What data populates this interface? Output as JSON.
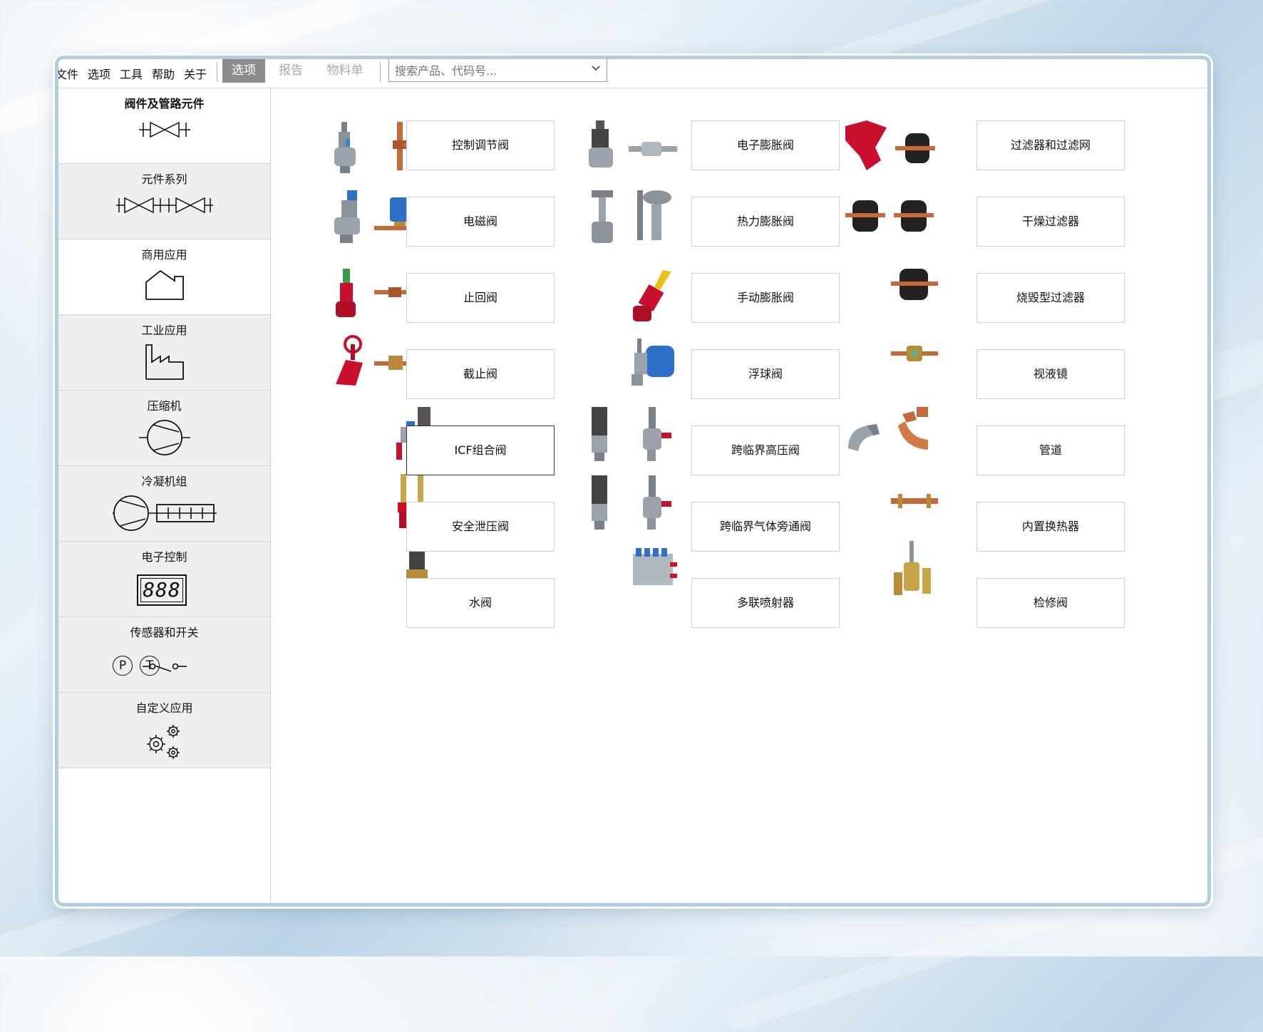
{
  "menu": {
    "items": [
      "文件",
      "选项",
      "工具",
      "帮助",
      "关于"
    ],
    "tabs": [
      {
        "label": "选项",
        "state": "active"
      },
      {
        "label": "报告",
        "state": "disabled"
      },
      {
        "label": "物料单",
        "state": "disabled"
      }
    ],
    "search_placeholder": "搜索产品、代码号..."
  },
  "sidebar": {
    "categories": [
      {
        "label": "阀件及管路元件",
        "icon": "valve-symbol-icon"
      },
      {
        "label": "元件系列",
        "icon": "double-valve-symbol-icon"
      },
      {
        "label": "商用应用",
        "icon": "house-outline-icon"
      },
      {
        "label": "工业应用",
        "icon": "factory-outline-icon"
      },
      {
        "label": "压缩机",
        "icon": "compressor-symbol-icon"
      },
      {
        "label": "冷凝机组",
        "icon": "condensing-unit-symbol-icon"
      },
      {
        "label": "电子控制",
        "icon": "digital-display-888-icon"
      },
      {
        "label": "传感器和开关",
        "icon": "pressure-temperature-switch-icon"
      },
      {
        "label": "自定义应用",
        "icon": "gears-icon"
      }
    ],
    "display_text": "888",
    "sensor_p": "P",
    "sensor_t": "T"
  },
  "products": {
    "col1": [
      "控制调节阀",
      "电磁阀",
      "止回阀",
      "截止阀",
      "ICF组合阀",
      "安全泄压阀",
      "水阀"
    ],
    "col2": [
      "电子膨胀阀",
      "热力膨胀阀",
      "手动膨胀阀",
      "浮球阀",
      "跨临界高压阀",
      "跨临界气体旁通阀",
      "多联喷射器"
    ],
    "col3": [
      "过滤器和过滤网",
      "干燥过滤器",
      "烧毁型过滤器",
      "视液镜",
      "管道",
      "内置换热器",
      "检修阀"
    ],
    "selected": "ICF组合阀"
  },
  "colors": {
    "accent_red": "#c8102e",
    "copper": "#c46a3a",
    "steel": "#9aa3ab",
    "tab_active": "#8c8c8c"
  }
}
